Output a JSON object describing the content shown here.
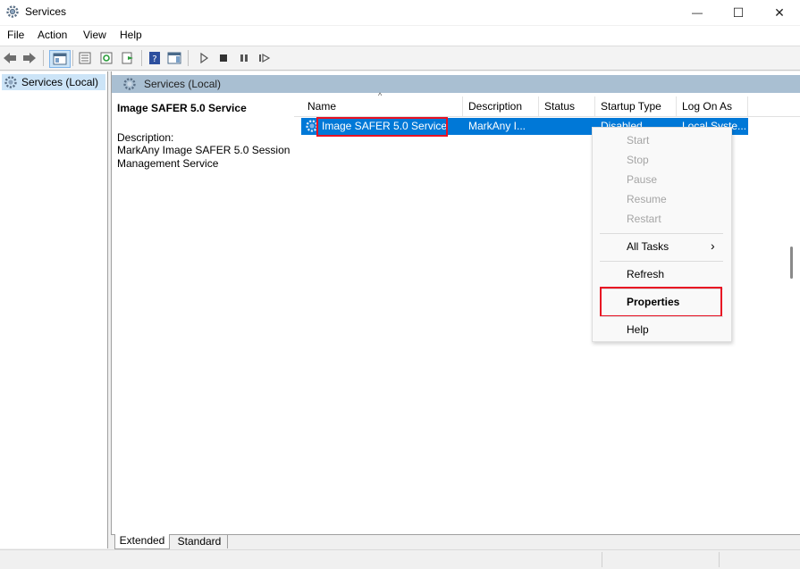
{
  "window": {
    "title": "Services",
    "minimize_glyph": "—",
    "maximize_glyph": "☐",
    "close_glyph": "✕"
  },
  "menu": [
    "File",
    "Action",
    "View",
    "Help"
  ],
  "toolbar": {
    "icons": [
      "back-icon",
      "forward-icon",
      "show-hide-tree-icon",
      "properties-icon",
      "refresh-icon",
      "export-list-icon",
      "help-icon",
      "show-action-pane-icon",
      "start-service-icon",
      "stop-service-icon",
      "pause-service-icon",
      "resume-service-icon"
    ]
  },
  "tree": {
    "root_label": "Services (Local)"
  },
  "pane": {
    "header_label": "Services (Local)"
  },
  "detail": {
    "service_name": "Image SAFER 5.0 Service",
    "description_label": "Description:",
    "description_text": "MarkAny Image SAFER 5.0 Session Management Service"
  },
  "list": {
    "columns": [
      "Name",
      "Description",
      "Status",
      "Startup Type",
      "Log On As"
    ],
    "selected_row": {
      "name": "Image SAFER 5.0 Service",
      "description": "MarkAny I...",
      "status": "",
      "startup_type": "Disabled",
      "log_on_as": "Local Syste..."
    }
  },
  "context_menu": {
    "start": "Start",
    "stop": "Stop",
    "pause": "Pause",
    "resume": "Resume",
    "restart": "Restart",
    "all_tasks": "All Tasks",
    "refresh": "Refresh",
    "properties": "Properties",
    "help": "Help",
    "submenu_arrow": "›"
  },
  "tabs": {
    "extended": "Extended",
    "standard": "Standard"
  },
  "colors": {
    "selection": "#0078d7",
    "highlight_box": "#e81123",
    "pane_header": "#a9bfd2"
  }
}
